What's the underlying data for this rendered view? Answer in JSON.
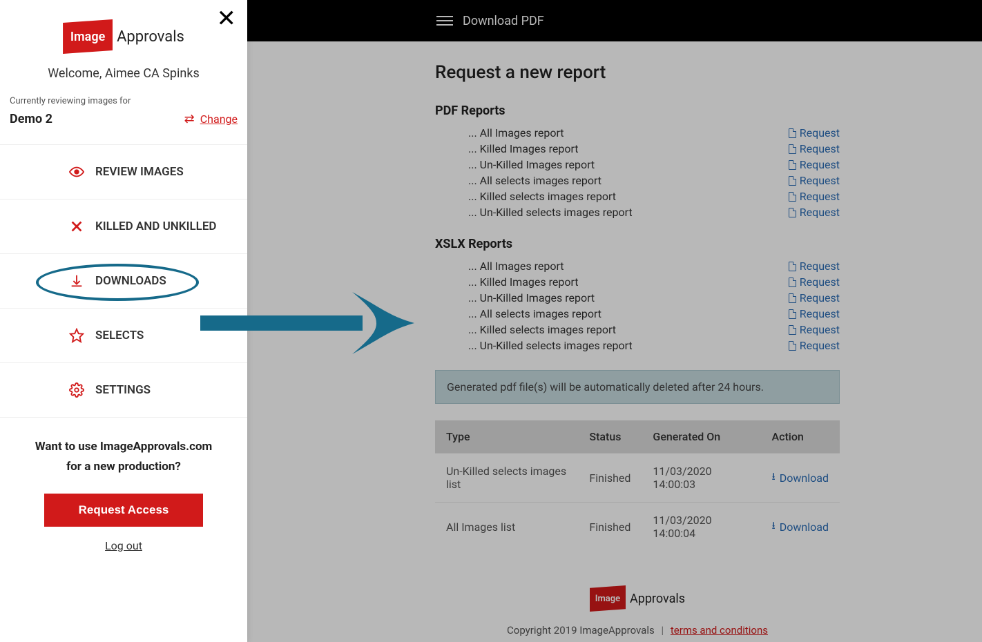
{
  "sidebar": {
    "logo_box": "Image",
    "logo_text": "Approvals",
    "welcome": "Welcome, Aimee CA Spinks",
    "reviewing_label": "Currently reviewing images for",
    "production_name": "Demo 2",
    "change_label": "Change",
    "nav": [
      {
        "key": "review-images",
        "label": "REVIEW IMAGES"
      },
      {
        "key": "killed-unkilled",
        "label": "KILLED AND UNKILLED"
      },
      {
        "key": "downloads",
        "label": "DOWNLOADS"
      },
      {
        "key": "selects",
        "label": "SELECTS"
      },
      {
        "key": "settings",
        "label": "SETTINGS"
      }
    ],
    "cta_line1": "Want to use ImageApprovals.com",
    "cta_line2": "for a new production?",
    "request_access": "Request Access",
    "logout": "Log out"
  },
  "topbar": {
    "title": "Download PDF"
  },
  "page": {
    "heading": "Request a new report",
    "pdf_section": "PDF Reports",
    "xlsx_section": "XSLX Reports",
    "reports": [
      "All Images report",
      "Killed Images report",
      "Un-Killed Images report",
      "All selects images report",
      "Killed selects images report",
      "Un-Killed selects images report"
    ],
    "request_label": "Request",
    "notice": "Generated pdf file(s) will be automatically deleted after 24 hours.",
    "table": {
      "headers": [
        "Type",
        "Status",
        "Generated On",
        "Action"
      ],
      "rows": [
        {
          "type": "Un-Killed selects images list",
          "status": "Finished",
          "generated": "11/03/2020 14:00:03",
          "action": "Download"
        },
        {
          "type": "All Images list",
          "status": "Finished",
          "generated": "11/03/2020 14:00:04",
          "action": "Download"
        }
      ]
    }
  },
  "footer": {
    "copyright": "Copyright 2019 ImageApprovals",
    "terms": "terms and conditions"
  }
}
